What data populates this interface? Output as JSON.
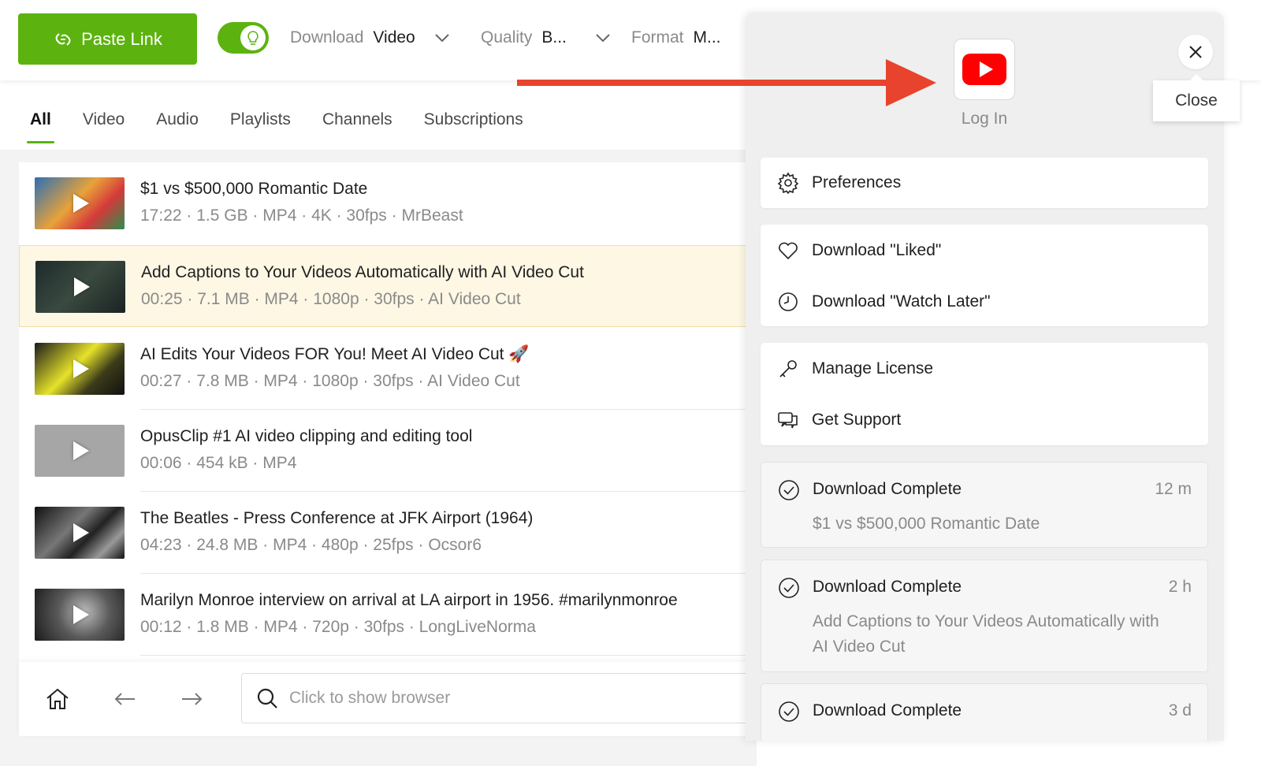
{
  "toolbar": {
    "paste_label": "Paste Link",
    "download": {
      "label": "Download",
      "value": "Video"
    },
    "quality": {
      "label": "Quality",
      "value": "B..."
    },
    "format": {
      "label": "Format",
      "value": "M..."
    }
  },
  "tabs": [
    "All",
    "Video",
    "Audio",
    "Playlists",
    "Channels",
    "Subscriptions"
  ],
  "media": [
    {
      "title": "$1 vs $500,000 Romantic Date",
      "meta": "17:22 · 1.5 GB · MP4 · 4K · 30fps · MrBeast"
    },
    {
      "title": "Add Captions to Your Videos Automatically with AI Video Cut",
      "meta": "00:25 · 7.1 MB · MP4 · 1080p · 30fps · AI Video Cut"
    },
    {
      "title": "AI Edits Your Videos FOR You! Meet AI Video Cut 🚀",
      "meta": "00:27 · 7.8 MB · MP4 · 1080p · 30fps · AI Video Cut"
    },
    {
      "title": "OpusClip #1 AI video clipping and editing tool",
      "meta": "00:06 · 454 kB · MP4"
    },
    {
      "title": "The Beatles - Press Conference at JFK Airport (1964)",
      "meta": "04:23 · 24.8 MB · MP4 · 480p · 25fps · Ocsor6"
    },
    {
      "title": "Marilyn Monroe interview on arrival at LA airport in 1956. #marilynmonroe",
      "meta": "00:12 · 1.8 MB · MP4 · 720p · 30fps · LongLiveNorma"
    }
  ],
  "browser": {
    "placeholder": "Click to show browser"
  },
  "panel": {
    "login_label": "Log In",
    "close_tooltip": "Close",
    "preferences": "Preferences",
    "download_liked": "Download \"Liked\"",
    "download_watch_later": "Download \"Watch Later\"",
    "manage_license": "Manage License",
    "get_support": "Get Support",
    "notifications": [
      {
        "title": "Download Complete",
        "time": "12 m",
        "subtitle": "$1 vs $500,000 Romantic Date"
      },
      {
        "title": "Download Complete",
        "time": "2 h",
        "subtitle": "Add Captions to Your Videos Automatically with AI Video Cut"
      },
      {
        "title": "Download Complete",
        "time": "3 d",
        "subtitle": ""
      }
    ]
  },
  "colors": {
    "accent": "#5cb30f",
    "youtube_red": "#ff0000",
    "arrow_red": "#e8432c",
    "highlight_row": "#fdf7e4"
  }
}
